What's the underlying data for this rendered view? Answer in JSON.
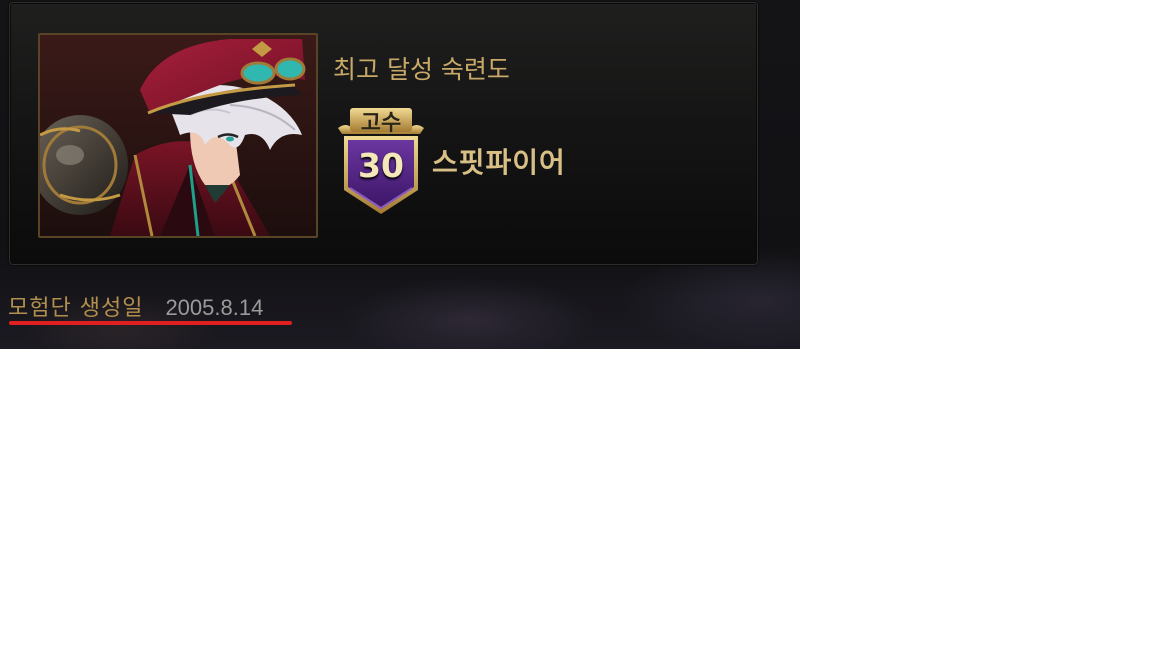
{
  "achievement": {
    "heading": "최고 달성 숙련도",
    "rank_label": "고수",
    "level": "30",
    "skill_name": "스핏파이어"
  },
  "founded": {
    "label": "모험단 생성일",
    "date": "2005.8.14"
  },
  "colors": {
    "gold_text": "#c9a968",
    "badge_purple": "#5a2a86",
    "underline_red": "#e02020"
  },
  "icons": {
    "badge": "rank-shield-icon",
    "portrait": "character-portrait"
  }
}
